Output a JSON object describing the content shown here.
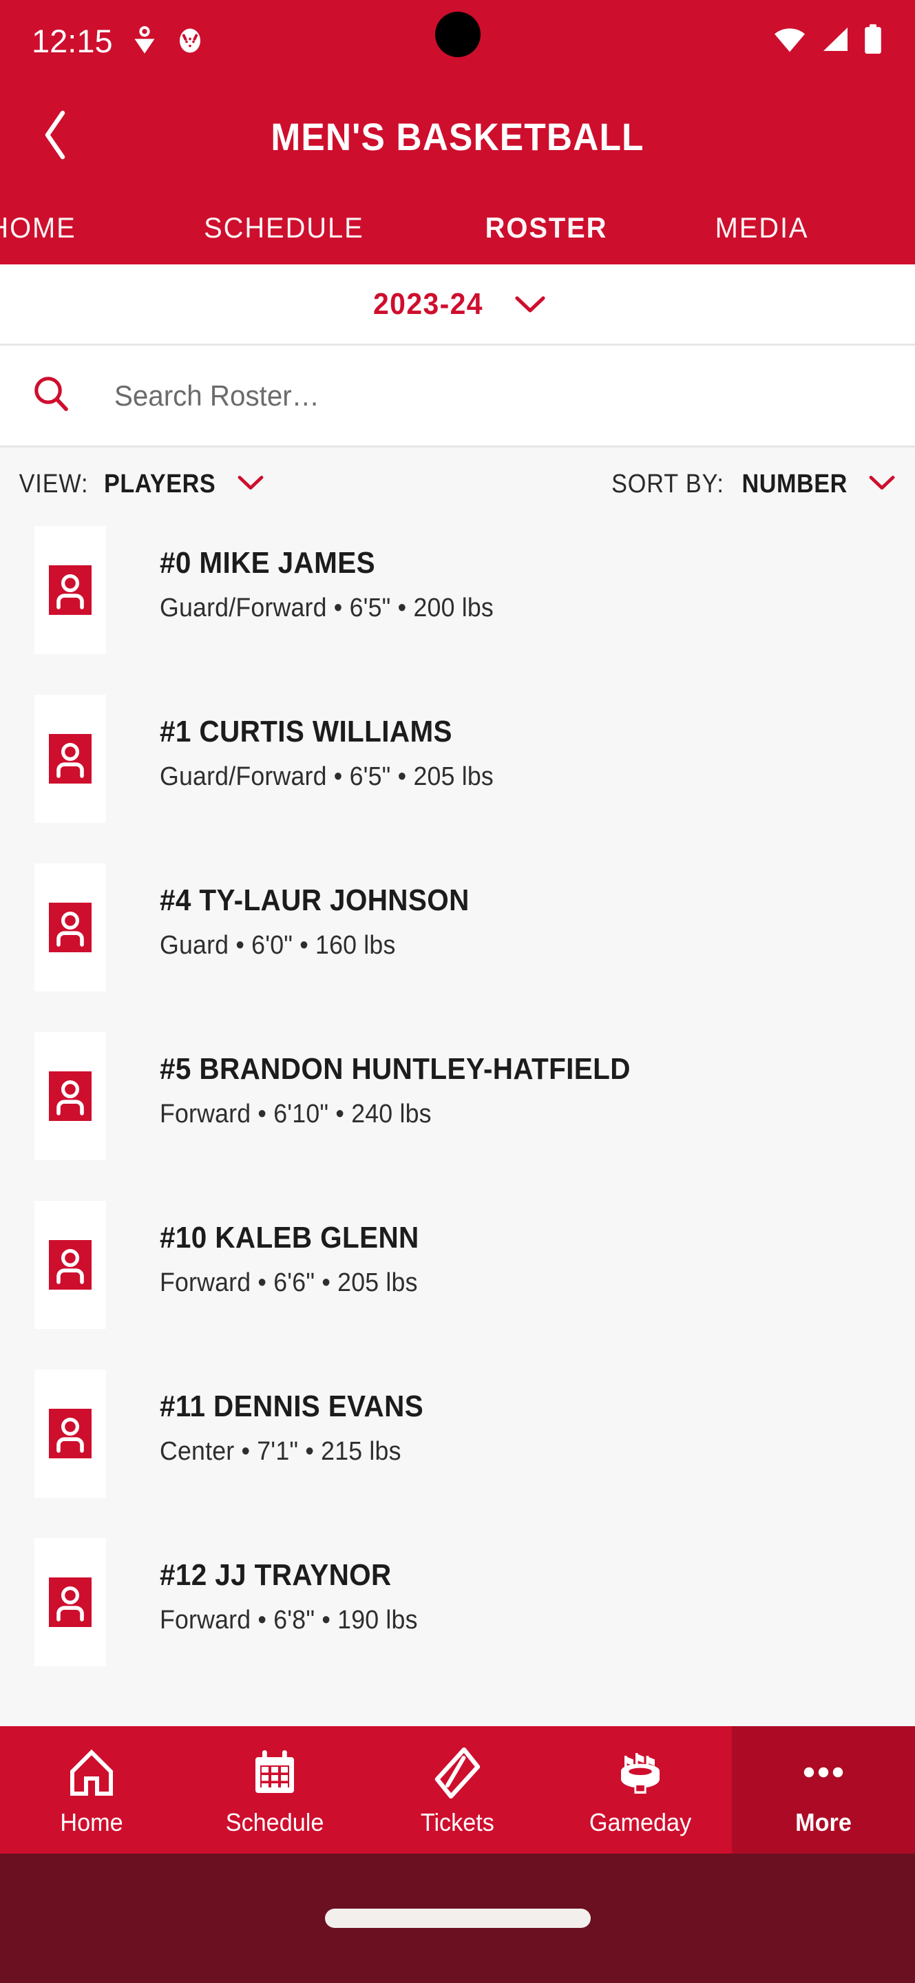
{
  "status_bar": {
    "time": "12:15",
    "left_icons": [
      "location-pin-icon",
      "app-badge-icon"
    ],
    "right_icons": [
      "wifi-icon",
      "cellular-signal-icon",
      "battery-icon"
    ]
  },
  "header": {
    "back_label": "back-chevron-icon",
    "title": "MEN'S BASKETBALL",
    "background_color": "#ce0e2d"
  },
  "tabs": [
    {
      "label": "HOME",
      "active": false
    },
    {
      "label": "SCHEDULE",
      "active": false
    },
    {
      "label": "ROSTER",
      "active": true
    },
    {
      "label": "MEDIA",
      "active": false
    }
  ],
  "season_selector": {
    "value": "2023-24",
    "accent_color": "#ce0e2d"
  },
  "search": {
    "placeholder": "Search Roster…",
    "value": ""
  },
  "filters": {
    "view": {
      "prefix": "VIEW:",
      "value": "PLAYERS"
    },
    "sort": {
      "prefix": "SORT BY:",
      "value": "NUMBER"
    }
  },
  "roster": [
    {
      "name": "#0 MIKE JAMES",
      "meta": "Guard/Forward • 6'5\" • 200 lbs"
    },
    {
      "name": "#1 CURTIS WILLIAMS",
      "meta": "Guard/Forward • 6'5\" • 205 lbs"
    },
    {
      "name": "#4 TY-LAUR JOHNSON",
      "meta": "Guard • 6'0\" • 160 lbs"
    },
    {
      "name": "#5 BRANDON HUNTLEY-HATFIELD",
      "meta": "Forward • 6'10\" • 240 lbs"
    },
    {
      "name": "#10 KALEB GLENN",
      "meta": "Forward • 6'6\" • 205 lbs"
    },
    {
      "name": "#11 DENNIS EVANS",
      "meta": "Center • 7'1\" • 215 lbs"
    },
    {
      "name": "#12 JJ TRAYNOR",
      "meta": "Forward • 6'8\" • 190 lbs"
    }
  ],
  "bottom_nav": [
    {
      "label": "Home",
      "icon": "home-icon",
      "active": false
    },
    {
      "label": "Schedule",
      "icon": "calendar-icon",
      "active": false
    },
    {
      "label": "Tickets",
      "icon": "ticket-icon",
      "active": false
    },
    {
      "label": "Gameday",
      "icon": "stadium-icon",
      "active": false
    },
    {
      "label": "More",
      "icon": "ellipsis-icon",
      "active": true
    }
  ]
}
